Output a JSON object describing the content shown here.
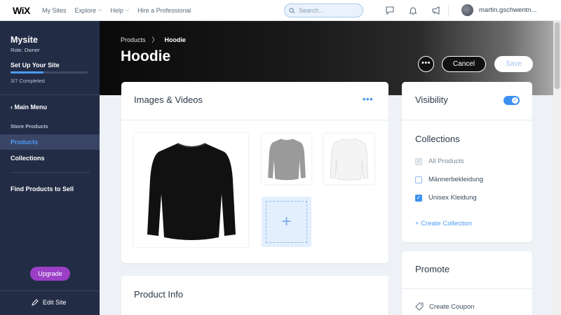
{
  "topbar": {
    "logo": "WiX",
    "nav": [
      {
        "label": "My Sites",
        "dropdown": false
      },
      {
        "label": "Explore",
        "dropdown": true
      },
      {
        "label": "Help",
        "dropdown": true
      },
      {
        "label": "Hire a Professional",
        "dropdown": false
      }
    ],
    "search_placeholder": "Search...",
    "user_name": "martin.gschwentn..."
  },
  "sidebar": {
    "site_name": "Mysite",
    "role": "Role: Owner",
    "setup_title": "Set Up Your Site",
    "setup_progress": 0.43,
    "setup_count": "3/7 Completed",
    "main_menu": "Main Menu",
    "section_label": "Store Products",
    "items": [
      {
        "label": "Products",
        "active": true
      },
      {
        "label": "Collections",
        "active": false
      }
    ],
    "find_products": "Find Products to Sell",
    "upgrade": "Upgrade",
    "edit_site": "Edit Site"
  },
  "header": {
    "breadcrumb_parent": "Products",
    "breadcrumb_current": "Hoodie",
    "title": "Hoodie",
    "more": "•••",
    "cancel": "Cancel",
    "save": "Save"
  },
  "images": {
    "title": "Images & Videos",
    "more": "•••",
    "add_symbol": "+",
    "items": [
      {
        "color": "#111111"
      },
      {
        "color": "#9a9a9a"
      },
      {
        "color": "#f4f4f4"
      }
    ]
  },
  "product_info": {
    "title": "Product Info"
  },
  "visibility": {
    "title": "Visibility",
    "enabled": true
  },
  "collections": {
    "title": "Collections",
    "items": [
      {
        "label": "All Products",
        "state": "disabled-checked"
      },
      {
        "label": "Männerbekleidung",
        "state": "unchecked"
      },
      {
        "label": "Unisex Kleidung",
        "state": "checked"
      }
    ],
    "create": "+ Create Collection"
  },
  "promote": {
    "title": "Promote",
    "coupon": "Create Coupon"
  },
  "colors": {
    "accent": "#3d8ff0",
    "sidebar_bg": "#222c45",
    "upgrade": "#9b3fc7"
  }
}
